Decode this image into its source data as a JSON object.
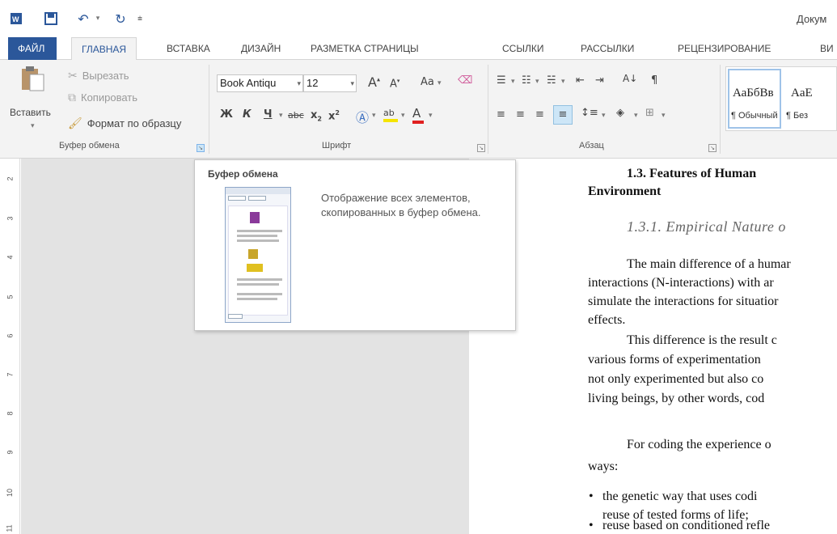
{
  "window": {
    "title": "Докум"
  },
  "qat": {
    "icons": [
      "word-icon",
      "save-icon",
      "undo-icon",
      "redo-icon",
      "customize-icon"
    ]
  },
  "tabs": [
    {
      "label": "ФАЙЛ"
    },
    {
      "label": "ГЛАВНАЯ"
    },
    {
      "label": "ВСТАВКА"
    },
    {
      "label": "ДИЗАЙН"
    },
    {
      "label": "РАЗМЕТКА СТРАНИЦЫ"
    },
    {
      "label": "ССЫЛКИ"
    },
    {
      "label": "РАССЫЛКИ"
    },
    {
      "label": "РЕЦЕНЗИРОВАНИЕ"
    },
    {
      "label": "ВИ"
    }
  ],
  "clipboard": {
    "paste_label": "Вставить",
    "cut_label": "Вырезать",
    "copy_label": "Копировать",
    "format_painter_label": "Формат по образцу",
    "group_label": "Буфер обмена"
  },
  "font": {
    "name": "Book Antiqu",
    "size": "12",
    "group_label": "Шрифт",
    "bold": "Ж",
    "italic": "К",
    "underline": "Ч",
    "strike": "abc",
    "change_case": "Aa"
  },
  "paragraph": {
    "group_label": "Абзац"
  },
  "styles": {
    "sample1": "АаБбВв",
    "sample2": "AaE",
    "name1": "¶ Обычный",
    "name2": "¶ Без"
  },
  "ruler": {
    "numbers": [
      "2",
      "3",
      "4",
      "5",
      "6",
      "7",
      "8",
      "9",
      "10",
      "11"
    ]
  },
  "tooltip": {
    "title": "Буфер обмена",
    "description": "Отображение всех элементов, скопированных в буфер обмена."
  },
  "document": {
    "heading": "1.3.  Features  of  Human",
    "heading2": "Environment",
    "subheading": "1.3.1. Empirical Nature o",
    "lines": [
      "The main difference of a humar",
      "interactions (N-interactions) with ar",
      "simulate the interactions for situatior",
      "effects.",
      "This difference is the result c",
      "various forms of experimentation",
      "not only experimented but also co",
      "living beings, by other words, cod",
      "For coding the experience o",
      "ways:"
    ],
    "bullets": [
      "the genetic way  that uses codi",
      "reuse of tested forms of life;",
      "reuse based on conditioned refle"
    ]
  }
}
